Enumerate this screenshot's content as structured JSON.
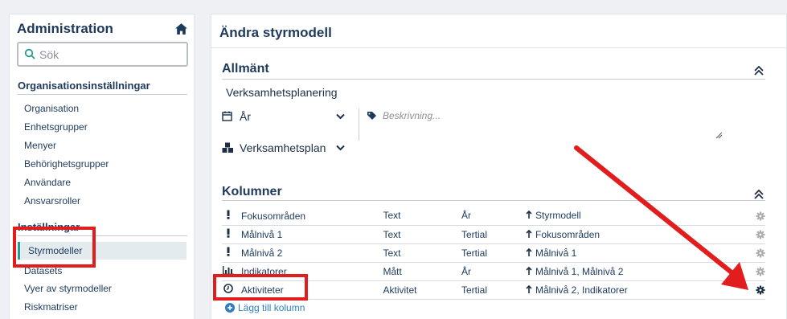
{
  "sidebar": {
    "title": "Administration",
    "search_placeholder": "Sök",
    "section1": "Organisationsinställningar",
    "section1_items": [
      "Organisation",
      "Enhetsgrupper",
      "Menyer",
      "Behörighetsgrupper",
      "Användare",
      "Ansvarsroller"
    ],
    "section2": "Inställningar",
    "active_item": "Styrmodeller",
    "section2_items": [
      "Datasets",
      "Vyer av styrmodeller",
      "Riskmatriser"
    ]
  },
  "main": {
    "title": "Ändra styrmodell",
    "general": {
      "header": "Allmänt",
      "name": "Verksamhetsplanering",
      "period": "År",
      "plan_type": "Verksamhetsplan",
      "description_placeholder": "Beskrivning..."
    },
    "columns": {
      "header": "Kolumner",
      "rows": [
        {
          "icon": "exclamation-icon",
          "name": "Fokusområden",
          "type": "Text",
          "period": "År",
          "parent": "Styrmodell"
        },
        {
          "icon": "exclamation-icon",
          "name": "Målnivå 1",
          "type": "Text",
          "period": "Tertial",
          "parent": "Fokusområden"
        },
        {
          "icon": "exclamation-icon",
          "name": "Målnivå 2",
          "type": "Text",
          "period": "Tertial",
          "parent": "Målnivå 1"
        },
        {
          "icon": "bar-chart-icon",
          "name": "Indikatorer",
          "type": "Mått",
          "period": "År",
          "parent": "Målnivå 1, Målnivå 2"
        },
        {
          "icon": "clock-icon",
          "name": "Aktiviteter",
          "type": "Aktivitet",
          "period": "Tertial",
          "parent": "Målnivå 2, Indikatorer"
        }
      ],
      "add_label": "Lägg till kolumn"
    }
  },
  "colors": {
    "accent": "#2b9b8f",
    "annotation_red": "#e11d1d",
    "heading": "#1d3a5c",
    "link": "#2f7fc0"
  }
}
